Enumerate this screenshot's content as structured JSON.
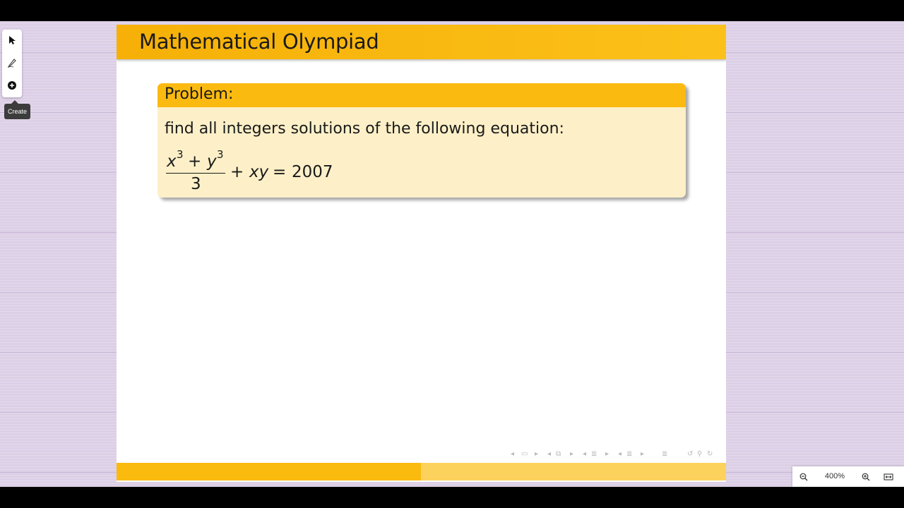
{
  "toolbar": {
    "tools": [
      {
        "name": "pointer-icon"
      },
      {
        "name": "pen-icon"
      },
      {
        "name": "add-circle-icon"
      }
    ],
    "tooltip": "Create"
  },
  "slide": {
    "title": "Mathematical Olympiad",
    "block": {
      "title": "Problem:",
      "text": "find all integers solutions of the following equation:",
      "equation": {
        "numerator_a": "x",
        "exp_a": "3",
        "plus": "+",
        "numerator_b": "y",
        "exp_b": "3",
        "denominator": "3",
        "rest_op": "+",
        "rest_var": "xy",
        "equals": "=",
        "rhs": "2007"
      }
    },
    "colors": {
      "header": "#f6b007",
      "block_header": "#fbba10",
      "block_body": "#fdf0c8",
      "footer_left": "#fbba0e",
      "footer_right": "#fdd25c"
    }
  },
  "zoom": {
    "level": "400%",
    "zoom_out_icon": "zoom-out-icon",
    "zoom_in_icon": "zoom-in-icon",
    "fit_icon": "fit-width-icon"
  },
  "background_color": "#dccfe6"
}
